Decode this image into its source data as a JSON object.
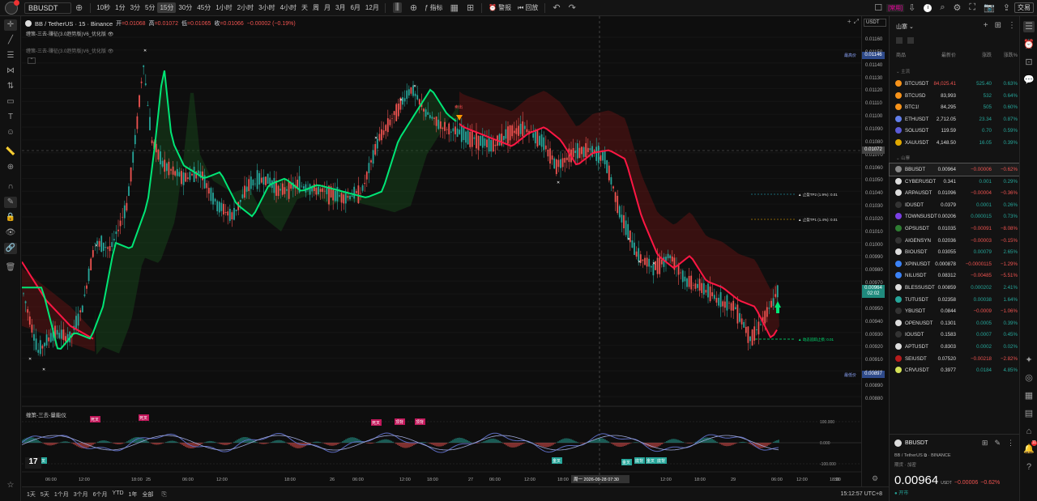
{
  "top": {
    "symbol": "BBUSDT",
    "timeframes": [
      "10秒",
      "1分",
      "3分",
      "5分",
      "15分",
      "30分",
      "45分",
      "1小时",
      "2小时",
      "3小时",
      "4小时",
      "天",
      "周",
      "月",
      "3月",
      "6月",
      "12月"
    ],
    "active_tf": "15分",
    "indicators": "指标",
    "alert": "警报",
    "replay": "回放",
    "trade": "交易",
    "prodtag": "[常用]",
    "avatar_badge": "8"
  },
  "legend": {
    "title": "BB / TetherUS · 15 · Binance",
    "open_l": "开",
    "open": "=0.01068",
    "high_l": "高",
    "high": "=0.01072",
    "low_l": "低",
    "low": "=0.01065",
    "close_l": "收",
    "close": "=0.01066",
    "chg": "−0.00002 (−0.19%)",
    "ind1": "缠策-三去-赚征(3.0趋势版)V6_优化版",
    "ind2": "缠策-三去-赚征(3.0趋势版)V6_优化版"
  },
  "chart_labels": {
    "max_label": "最高价",
    "min_label": "最低价",
    "tp2": "▲ 止盈TP2 (1.9%): 0.01",
    "tp1": "▲ 止盈TP1 (1.4%): 0.01",
    "sl": "▲ 动态追踪止损: 0.01",
    "sell": "卖出",
    "osc_title": "缠策-三去-量能仪",
    "osc_ticks": [
      "100.000",
      "0.000",
      "-100.000"
    ],
    "osc_tags": [
      {
        "t": "死叉",
        "c": "#c2185b"
      },
      {
        "t": "死叉",
        "c": "#c2185b"
      },
      {
        "t": "死叉",
        "c": "#c2185b"
      },
      {
        "t": "顶背",
        "c": "#c2185b"
      },
      {
        "t": "顶背",
        "c": "#c2185b"
      },
      {
        "t": "金叉",
        "c": "#26a69a"
      },
      {
        "t": "金叉",
        "c": "#26a69a"
      },
      {
        "t": "底背",
        "c": "#26a69a"
      },
      {
        "t": "金叉",
        "c": "#26a69a"
      },
      {
        "t": "底背",
        "c": "#26a69a"
      },
      {
        "t": "金叉",
        "c": "#26a69a"
      }
    ]
  },
  "price_scale": {
    "currency": "USDT",
    "ticks": [
      "0.01160",
      "0.01150",
      "0.01140",
      "0.01130",
      "0.01120",
      "0.01110",
      "0.01100",
      "0.01090",
      "0.01080",
      "0.01070",
      "0.01060",
      "0.01050",
      "0.01040",
      "0.01030",
      "0.01020",
      "0.01010",
      "0.01000",
      "0.00990",
      "0.00980",
      "0.00970",
      "0.00960",
      "0.00950",
      "0.00940",
      "0.00930",
      "0.00920",
      "0.00910",
      "0.00900",
      "0.00890",
      "0.00880"
    ],
    "max_tag": "0.01146",
    "cross_tag": "0.01072",
    "last_tag": "0.00964",
    "last_time": "02:02",
    "min_tag": "0.00897"
  },
  "time_axis": {
    "labels": [
      "06:00",
      "12:00",
      "18:00",
      "25",
      "06:00",
      "12:00",
      "18:00",
      "26",
      "06:00",
      "12:00",
      "18:00",
      "27",
      "06:00",
      "12:00",
      "18:00",
      "28",
      "12:00",
      "18:00",
      "29",
      "06:00",
      "12:00",
      "18:00",
      "30"
    ],
    "cursor": "周一 2026-09-28  07:30"
  },
  "bottom": {
    "ranges": [
      "1天",
      "5天",
      "1个月",
      "3个月",
      "6个月",
      "YTD",
      "1年",
      "全部"
    ],
    "clock": "15:12:57 UTC+8"
  },
  "watchlist": {
    "title": "山寨",
    "cols": [
      "商品",
      "最新价",
      "涨跌",
      "涨跌%"
    ],
    "section1": "主流",
    "section2": "山寨",
    "rows1": [
      {
        "n": "BTCUSDT",
        "p": "84,025.41",
        "c": "525.40",
        "pc": "0.63%",
        "col": "#f7931a",
        "pdn": true
      },
      {
        "n": "BTCUSD",
        "p": "83,993",
        "c": "532",
        "pc": "0.64%",
        "col": "#f7931a"
      },
      {
        "n": "BTC1!",
        "p": "84,295",
        "c": "505",
        "pc": "0.60%",
        "col": "#f7931a"
      },
      {
        "n": "ETHUSDT",
        "p": "2,712.05",
        "c": "23.34",
        "pc": "0.87%",
        "col": "#627eea"
      },
      {
        "n": "SOLUSDT",
        "p": "119.59",
        "c": "0.70",
        "pc": "0.59%",
        "col": "#5b5bd6"
      },
      {
        "n": "XAUUSDT",
        "p": "4,148.50",
        "c": "16.05",
        "pc": "0.39%",
        "col": "#e0a800"
      }
    ],
    "rows2": [
      {
        "n": "BBUSDT",
        "p": "0.00964",
        "c": "−0.00006",
        "pc": "−0.62%",
        "col": "#888",
        "dn": true,
        "sel": true
      },
      {
        "n": "CYBERUSDT",
        "p": "0.341",
        "c": "0.001",
        "pc": "0.29%",
        "col": "#ddd"
      },
      {
        "n": "ARPAUSDT",
        "p": "0.01096",
        "c": "−0.00004",
        "pc": "−0.36%",
        "col": "#ddd",
        "dn": true
      },
      {
        "n": "IDUSDT",
        "p": "0.0379",
        "c": "0.0001",
        "pc": "0.26%",
        "col": "#333"
      },
      {
        "n": "TOWNSUSDT",
        "p": "0.00206",
        "c": "0.000015",
        "pc": "0.73%",
        "col": "#7b3fe4"
      },
      {
        "n": "GPSUSDT",
        "p": "0.01035",
        "c": "−0.00091",
        "pc": "−8.08%",
        "col": "#2e7d32",
        "dn": true
      },
      {
        "n": "AIGENSYN",
        "p": "0.02036",
        "c": "−0.00003",
        "pc": "−0.15%",
        "col": "#333",
        "dn": true
      },
      {
        "n": "BIOUSDT",
        "p": "0.03055",
        "c": "0.00079",
        "pc": "2.65%",
        "col": "#ddd"
      },
      {
        "n": "XPINUSDT",
        "p": "0.000878",
        "c": "−0.0000115",
        "pc": "−1.29%",
        "col": "#3b82f6",
        "dn": true
      },
      {
        "n": "NILUSDT",
        "p": "0.08312",
        "c": "−0.00485",
        "pc": "−5.51%",
        "col": "#3b82f6",
        "dn": true
      },
      {
        "n": "BLESSUSDT",
        "p": "0.00859",
        "c": "0.000202",
        "pc": "2.41%",
        "col": "#ddd"
      },
      {
        "n": "TUTUSDT",
        "p": "0.02358",
        "c": "0.00038",
        "pc": "1.64%",
        "col": "#26a69a"
      },
      {
        "n": "YBUSDT",
        "p": "0.0844",
        "c": "−0.0009",
        "pc": "−1.06%",
        "col": "#333",
        "dn": true
      },
      {
        "n": "OPENUSDT",
        "p": "0.1301",
        "c": "0.0005",
        "pc": "0.39%",
        "col": "#ddd"
      },
      {
        "n": "IOUSDT",
        "p": "0.1583",
        "c": "0.0007",
        "pc": "0.45%",
        "col": "#333"
      },
      {
        "n": "APTUSDT",
        "p": "0.8303",
        "c": "0.0002",
        "pc": "0.02%",
        "col": "#ddd"
      },
      {
        "n": "SEIUSDT",
        "p": "0.07520",
        "c": "−0.00218",
        "pc": "−2.82%",
        "col": "#b71c1c",
        "dn": true
      },
      {
        "n": "CRVUSDT",
        "p": "0.3977",
        "c": "0.0184",
        "pc": "4.85%",
        "col": "#d4e157"
      }
    ]
  },
  "detail": {
    "sym": "BBUSDT",
    "full": "BB / TetherUS",
    "exch": "BINANCE",
    "sub": "期货 · 加密",
    "price": "0.00964",
    "cur": "USDT",
    "chg": "−0.00006",
    "pct": "−0.62%",
    "status": "开市"
  },
  "right_badge": "11"
}
